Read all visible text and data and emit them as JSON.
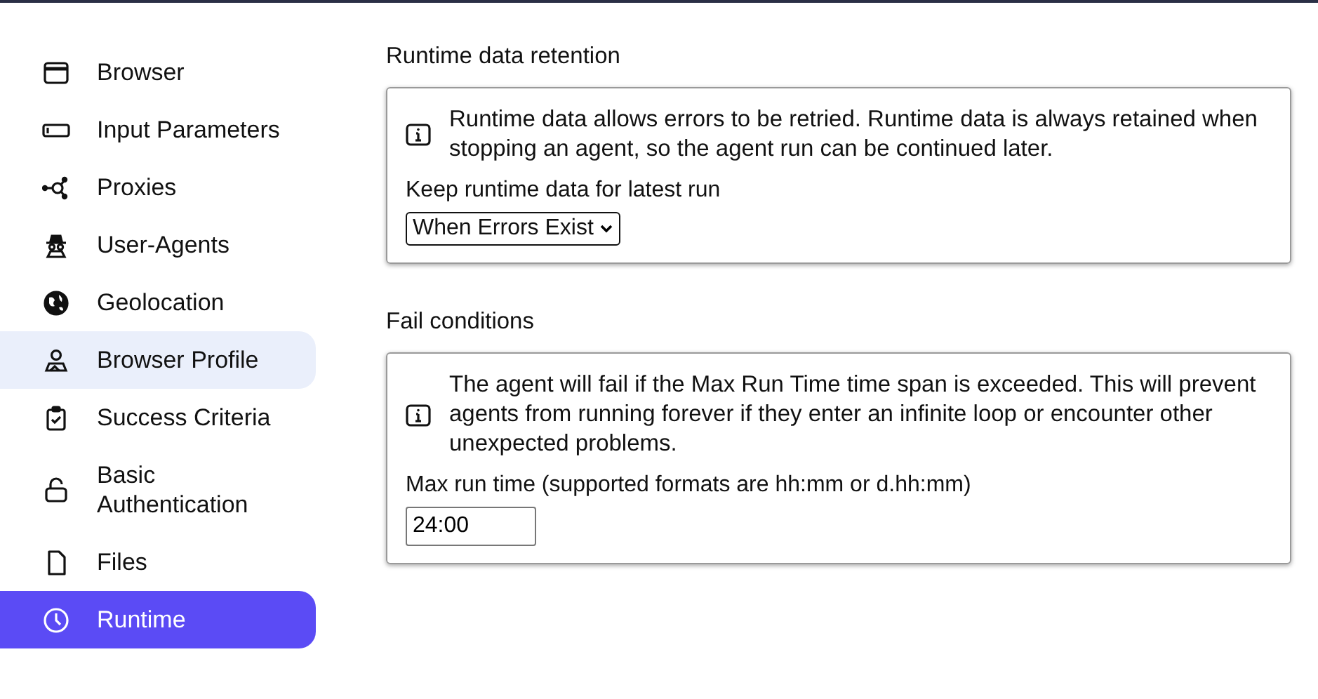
{
  "sidebar": {
    "items": [
      {
        "label": "Browser",
        "selected": false,
        "hovered": false
      },
      {
        "label": "Input Parameters",
        "selected": false,
        "hovered": false
      },
      {
        "label": "Proxies",
        "selected": false,
        "hovered": false
      },
      {
        "label": "User-Agents",
        "selected": false,
        "hovered": false
      },
      {
        "label": "Geolocation",
        "selected": false,
        "hovered": false
      },
      {
        "label": "Browser Profile",
        "selected": false,
        "hovered": true
      },
      {
        "label": "Success Criteria",
        "selected": false,
        "hovered": false
      },
      {
        "label": "Basic Authentication",
        "selected": false,
        "hovered": false
      },
      {
        "label": "Files",
        "selected": false,
        "hovered": false
      },
      {
        "label": "Runtime",
        "selected": true,
        "hovered": false
      }
    ]
  },
  "sections": [
    {
      "title": "Runtime data retention",
      "info": "Runtime data allows errors to be retried. Runtime data is always retained when stopping an agent, so the agent run can be continued later.",
      "field_label": "Keep runtime data for latest run",
      "field": {
        "kind": "select",
        "value": "When Errors Exist"
      }
    },
    {
      "title": "Fail conditions",
      "info": "The agent will fail if the Max Run Time time span is exceeded. This will prevent agents from running forever if they enter an infinite loop or encounter other unexpected problems.",
      "field_label": "Max run time (supported formats are hh:mm or d.hh:mm)",
      "field": {
        "kind": "text",
        "value": "24:00"
      }
    }
  ]
}
